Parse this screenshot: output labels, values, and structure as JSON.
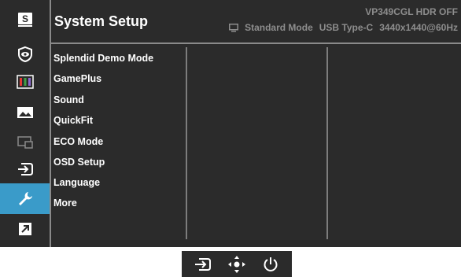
{
  "header": {
    "title": "System Setup",
    "model": "VP349CGL HDR OFF",
    "status": {
      "mode": "Standard Mode",
      "input": "USB Type-C",
      "resolution": "3440x1440@60Hz"
    }
  },
  "sidebar": {
    "items": [
      {
        "icon": "splendid-s-icon",
        "active": false
      },
      {
        "icon": "eye-care-icon",
        "active": false
      },
      {
        "icon": "color-bars-icon",
        "active": false
      },
      {
        "icon": "image-icon",
        "active": false
      },
      {
        "icon": "pip-icon",
        "active": false
      },
      {
        "icon": "input-select-icon",
        "active": false
      },
      {
        "icon": "wrench-icon",
        "active": true
      },
      {
        "icon": "shortcut-arrow-icon",
        "active": false
      }
    ]
  },
  "menu": {
    "items": [
      {
        "label": "Splendid Demo Mode"
      },
      {
        "label": "GamePlus"
      },
      {
        "label": "Sound"
      },
      {
        "label": "QuickFit"
      },
      {
        "label": "ECO Mode"
      },
      {
        "label": "OSD Setup"
      },
      {
        "label": "Language"
      },
      {
        "label": "More"
      }
    ]
  },
  "keys": {
    "items": [
      {
        "icon": "input-select-icon"
      },
      {
        "icon": "five-way-navigation-icon"
      },
      {
        "icon": "power-icon"
      }
    ]
  },
  "colors": {
    "background": "#2b2b2b",
    "accent": "#3a9bc9",
    "separator": "#8a8a8a",
    "muted_text": "#8d8d8d",
    "text": "#ffffff"
  }
}
